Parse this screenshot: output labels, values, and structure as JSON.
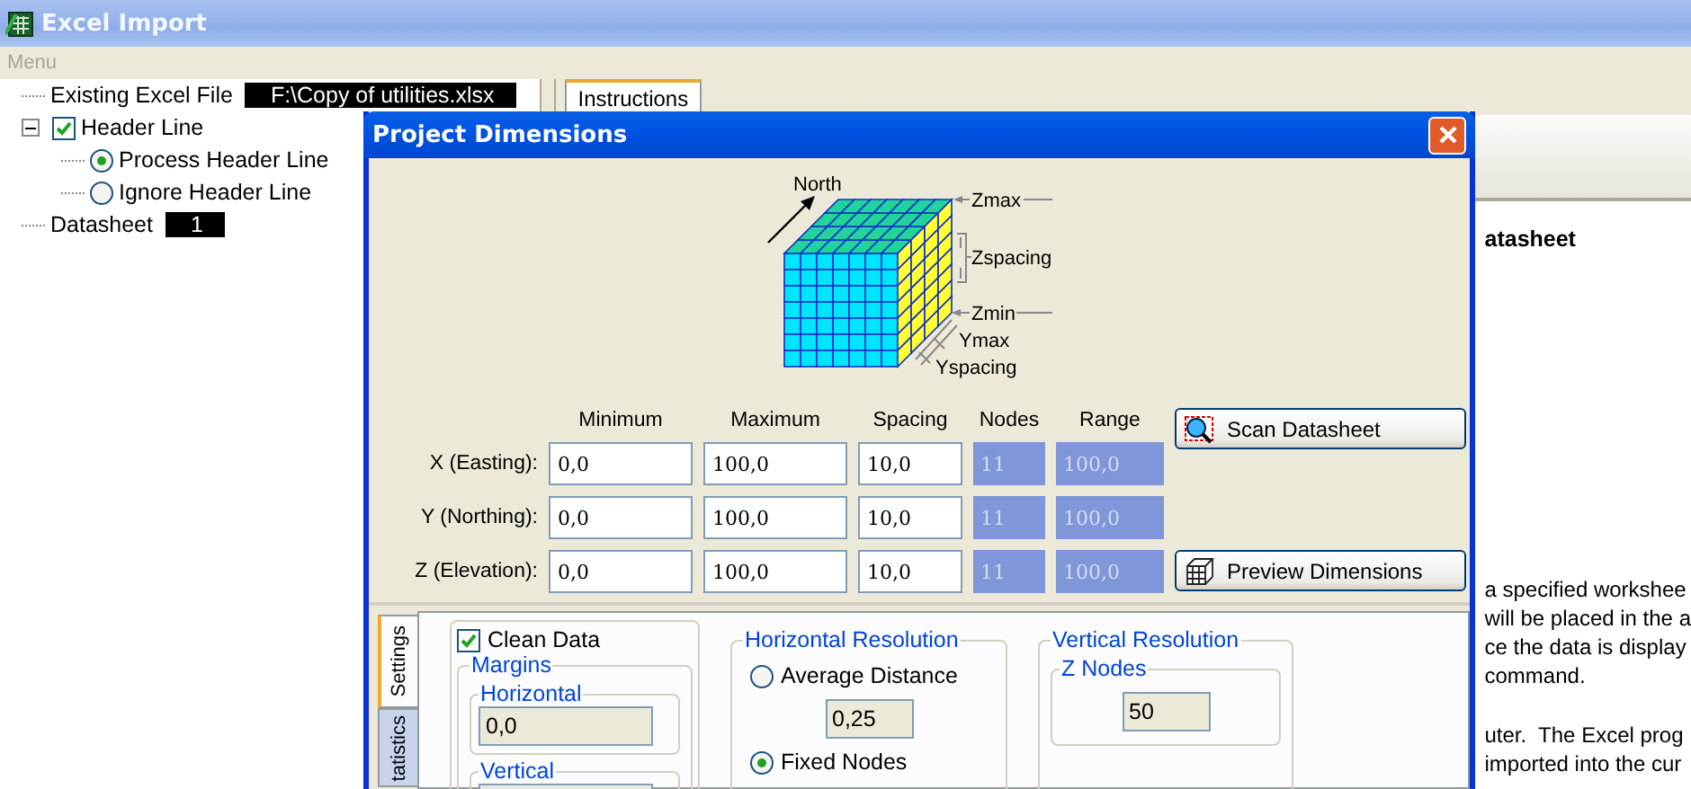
{
  "window": {
    "title": "Excel Import"
  },
  "menu": [
    {
      "label": "Menu",
      "disabled": true
    }
  ],
  "tree": [
    {
      "kind": "field",
      "label": "Existing Excel File",
      "value": "F:\\Copy of utilities.xlsx"
    },
    {
      "kind": "checkbox",
      "label": "Header Line",
      "checked": true,
      "expanded": true,
      "children": [
        {
          "kind": "radio",
          "label": "Process Header Line",
          "selected": true
        },
        {
          "kind": "radio",
          "label": "Ignore Header Line",
          "selected": false
        }
      ]
    },
    {
      "kind": "field",
      "label": "Datasheet",
      "value": "1"
    }
  ],
  "instructions": {
    "tab": {
      "label": "Instructions",
      "selected": true
    },
    "heading": "atasheet",
    "paragraphs": [
      [
        "a specified workshee",
        "will be placed in the a",
        "ce the data is display",
        "command."
      ],
      [
        "uter.  The Excel prog",
        "imported into the cur"
      ]
    ]
  },
  "dialog": {
    "title": "Project Dimensions",
    "diagram_labels": {
      "north": "North",
      "zmax": "Zmax",
      "zspacing": "Zspacing",
      "zmin": "Zmin",
      "ymax": "Ymax",
      "yspacing": "Yspacing"
    },
    "columns": [
      "Minimum",
      "Maximum",
      "Spacing",
      "Nodes",
      "Range"
    ],
    "rows": [
      {
        "label": "X (Easting):",
        "minimum": "0,0",
        "maximum": "100,0",
        "spacing": "10,0",
        "nodes": "11",
        "range": "100,0"
      },
      {
        "label": "Y (Northing):",
        "minimum": "0,0",
        "maximum": "100,0",
        "spacing": "10,0",
        "nodes": "11",
        "range": "100,0"
      },
      {
        "label": "Z (Elevation):",
        "minimum": "0,0",
        "maximum": "100,0",
        "spacing": "10,0",
        "nodes": "11",
        "range": "100,0"
      }
    ],
    "buttons": [
      {
        "label": "Scan Datasheet",
        "kind": "scan"
      },
      {
        "label": "Preview Dimensions",
        "kind": "preview"
      }
    ],
    "side_tabs": [
      {
        "label": "Settings",
        "selected": true
      },
      {
        "label": "tatistics",
        "selected": false
      }
    ],
    "clean_data": {
      "label": "Clean Data",
      "checked": true
    },
    "margins": {
      "label": "Margins",
      "groups": [
        {
          "label": "Horizontal",
          "value": "0,0"
        },
        {
          "label": "Vertical"
        }
      ]
    },
    "horizontal_resolution": {
      "label": "Horizontal Resolution",
      "options": [
        {
          "label": "Average Distance",
          "selected": false,
          "value": "0,25"
        },
        {
          "label": "Fixed Nodes",
          "selected": true
        }
      ]
    },
    "vertical_resolution": {
      "label": "Vertical Resolution",
      "group": "Z Nodes",
      "value": "50"
    }
  }
}
